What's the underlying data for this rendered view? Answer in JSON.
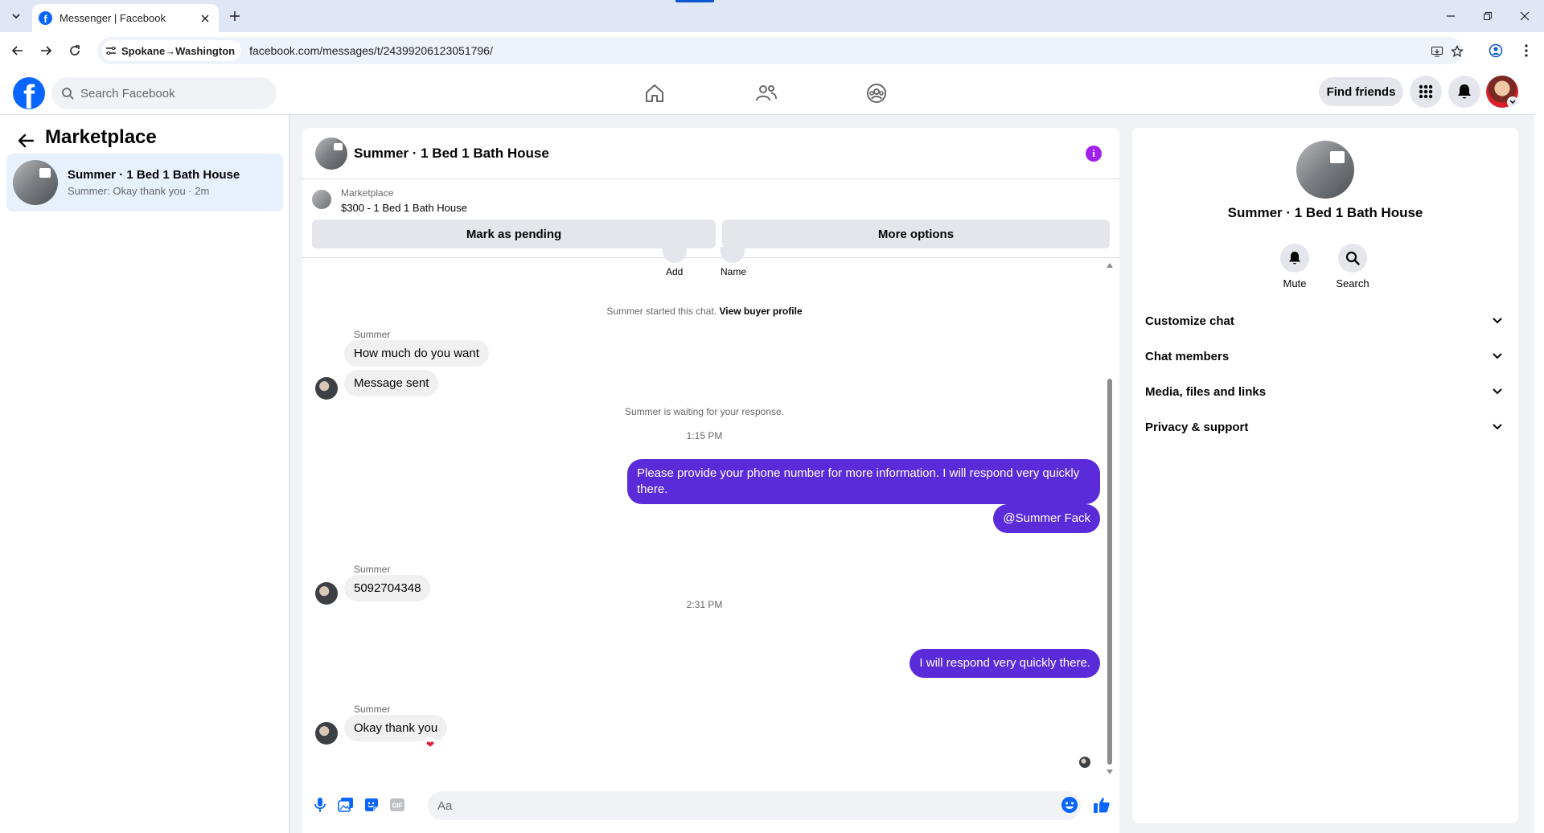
{
  "browser": {
    "tab_title": "Messenger | Facebook",
    "site_chip": "Spokane→Washington",
    "url": "facebook.com/messages/t/24399206123051796/"
  },
  "fb": {
    "search_placeholder": "Search Facebook",
    "find_friends": "Find friends"
  },
  "left": {
    "title": "Marketplace",
    "conversation": {
      "name": "Summer · 1 Bed 1 Bath House",
      "preview": "Summer: Okay thank you · 2m"
    }
  },
  "chat": {
    "header_name": "Summer · 1 Bed 1 Bath House",
    "marketplace": {
      "label": "Marketplace",
      "listing": "$300 - 1 Bed 1 Bath House",
      "mark_pending": "Mark as pending",
      "more_options": "More options"
    },
    "partial_labels": [
      "Add",
      "Name"
    ],
    "started": "Summer started this chat.",
    "view_buyer": "View buyer profile",
    "waiting": "Summer is waiting for your response.",
    "sender": "Summer",
    "times": [
      "1:15 PM",
      "2:31 PM"
    ],
    "messages_in": [
      "How much do you want",
      "Message sent",
      "5092704348",
      "Okay thank you"
    ],
    "messages_out": [
      "Please provide your phone number for more information. I will respond very quickly there.",
      "@Summer Fack",
      "I will respond very quickly there."
    ],
    "reaction": "❤",
    "composer_placeholder": "Aa"
  },
  "info": {
    "name": "Summer · 1 Bed 1 Bath House",
    "actions": [
      "Mute",
      "Search"
    ],
    "sections": [
      "Customize chat",
      "Chat members",
      "Media, files and links",
      "Privacy & support"
    ]
  },
  "colors": {
    "fb_blue": "#0866ff",
    "outgoing_bubble": "#5b2bd9",
    "incoming_bubble": "#f0f0f0",
    "info_icon": "#a020f0"
  }
}
